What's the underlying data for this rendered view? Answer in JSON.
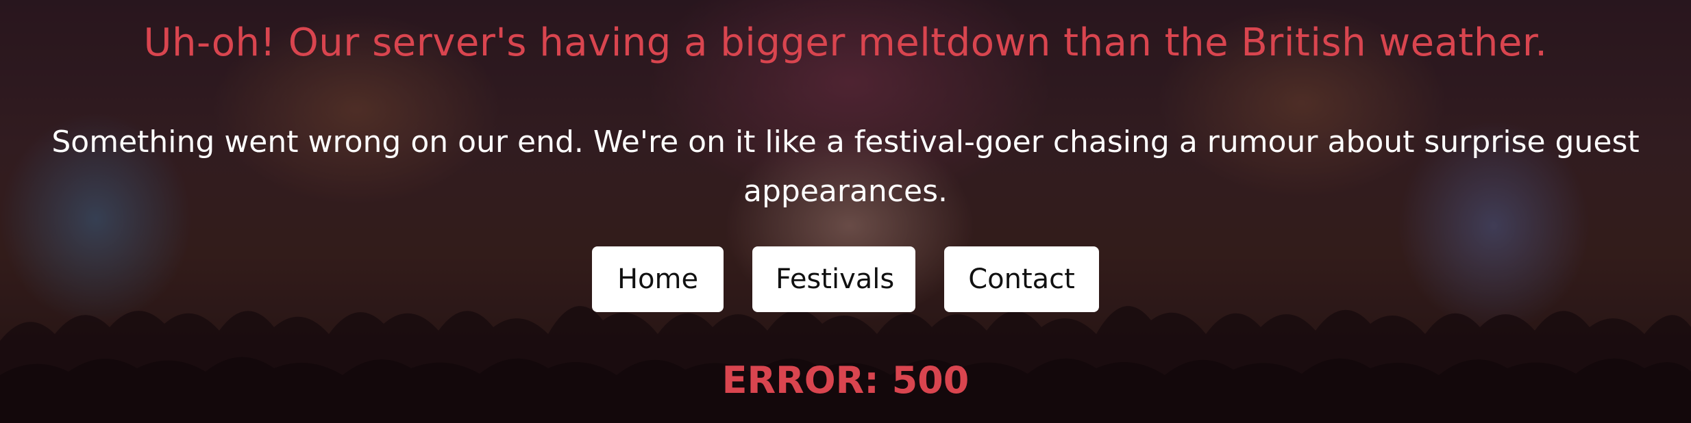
{
  "headline": "Uh-oh! Our server's having a bigger meltdown than the British weather.",
  "message": "Something went wrong on our end. We're on it like a festival-goer chasing a rumour about surprise guest appearances.",
  "nav": {
    "home": "Home",
    "festivals": "Festivals",
    "contact": "Contact"
  },
  "error_code": "ERROR: 500",
  "colors": {
    "accent": "#d9454f",
    "text": "#ffffff",
    "button_bg": "#ffffff",
    "button_text": "#111111"
  }
}
